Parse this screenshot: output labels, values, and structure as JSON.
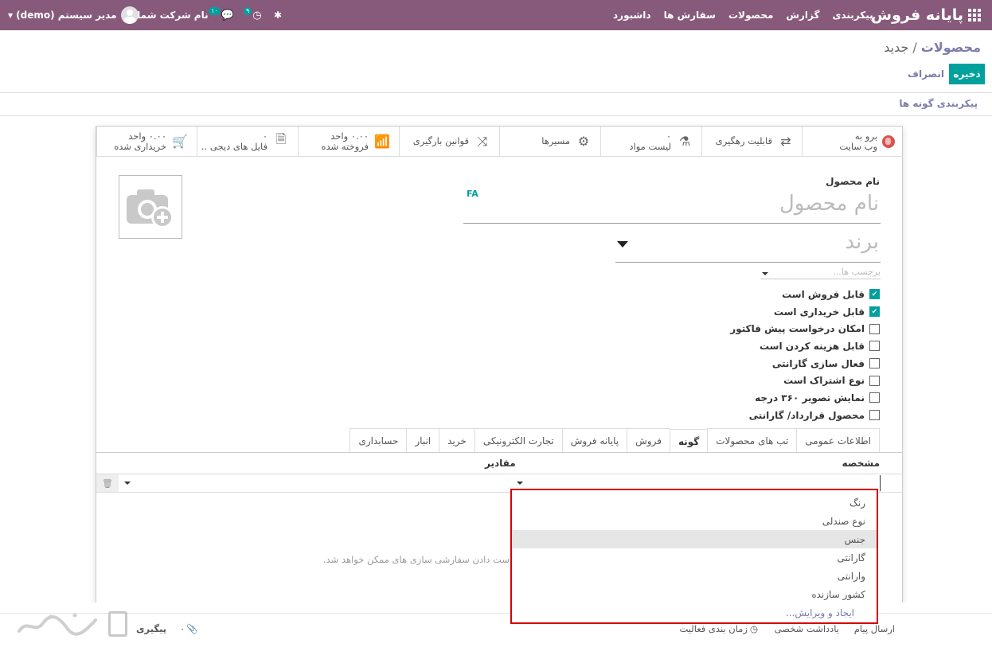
{
  "navbar": {
    "app_name": "پایانه فروش",
    "menu": [
      "داشبورد",
      "سفارش ها",
      "محصولات",
      "گزارش",
      "پیکربندی"
    ],
    "company": "نام شرکت شما",
    "user": "مدیر سیستم (demo)",
    "chat_badge": "۱۰",
    "activity_badge": "۹",
    "bg_color": "#875a7b"
  },
  "breadcrumb": {
    "parent": "محصولات",
    "sep": "/",
    "current": "جدید"
  },
  "buttons": {
    "save": "ذخیره",
    "discard": "انصراف",
    "configure_variants": "پیکربندی گونه ها"
  },
  "button_box": [
    {
      "line1": "برو به",
      "line2": "وب سایت",
      "icon": "globe-icon"
    },
    {
      "line1": "قابلیت رهگیری",
      "line2": "",
      "icon": "exchange-icon"
    },
    {
      "line1": "۰",
      "line2": "لیست مواد",
      "icon": "flask-icon"
    },
    {
      "line1": "مسیرها",
      "line2": "",
      "icon": "cogs-icon"
    },
    {
      "line1": "قوانین بارگیری",
      "line2": "",
      "icon": "random-icon"
    },
    {
      "line1": "۰.۰۰ واحد",
      "line2": "فروخته شده",
      "icon": "bar-chart-icon"
    },
    {
      "line1": "۰",
      "line2": "فایل های دیجی ..",
      "icon": "file-icon"
    },
    {
      "line1": "۰.۰۰ واحد",
      "line2": "خریداری شده",
      "icon": "cart-icon"
    }
  ],
  "form": {
    "name_label": "نام محصول",
    "name_placeholder": "نام محصول",
    "lang": "FA",
    "brand_placeholder": "برند",
    "tags_placeholder": "برچسب ها..."
  },
  "checkboxes": [
    {
      "label": "قابل فروش است",
      "checked": true
    },
    {
      "label": "قابل خریداری است",
      "checked": true
    },
    {
      "label": "امکان درخواست پیش فاکتور",
      "checked": false
    },
    {
      "label": "قابل هزینه کردن است",
      "checked": false
    },
    {
      "label": "فعال سازی گارانتی",
      "checked": false
    },
    {
      "label": "نوع اشتراک است",
      "checked": false
    },
    {
      "label": "نمایش تصویر ۳۶۰ درجه",
      "checked": false
    },
    {
      "label": "محصول قرارداد/ گارانتی",
      "checked": false
    }
  ],
  "tabs": [
    {
      "label": "اطلاعات عمومی",
      "active": false
    },
    {
      "label": "تب های محصولات",
      "active": false
    },
    {
      "label": "گونه",
      "active": true
    },
    {
      "label": "فروش",
      "active": false
    },
    {
      "label": "پایانه فروش",
      "active": false
    },
    {
      "label": "تجارت الکترونیکی",
      "active": false
    },
    {
      "label": "خرید",
      "active": false
    },
    {
      "label": "انبار",
      "active": false
    },
    {
      "label": "حسابداری",
      "active": false
    }
  ],
  "variants_table": {
    "col_attribute": "مشخصه",
    "col_values": "مقادیر",
    "hint": "ز دست دادن سفارشی سازی های ممکن خواهد شد."
  },
  "dropdown": {
    "items": [
      "رنگ",
      "نوع صندلی",
      "جنس",
      "گارانتی",
      "وارانتی",
      "کشور سازنده"
    ],
    "highlighted": "جنس",
    "create_edit": "ایجاد و ویرایش..."
  },
  "chatter": {
    "send_message": "ارسال پیام",
    "log_note": "یادداشت شخصی",
    "schedule_activity": "زمان بندی فعالیت",
    "follow": "پیگیری",
    "followers": "۰"
  }
}
